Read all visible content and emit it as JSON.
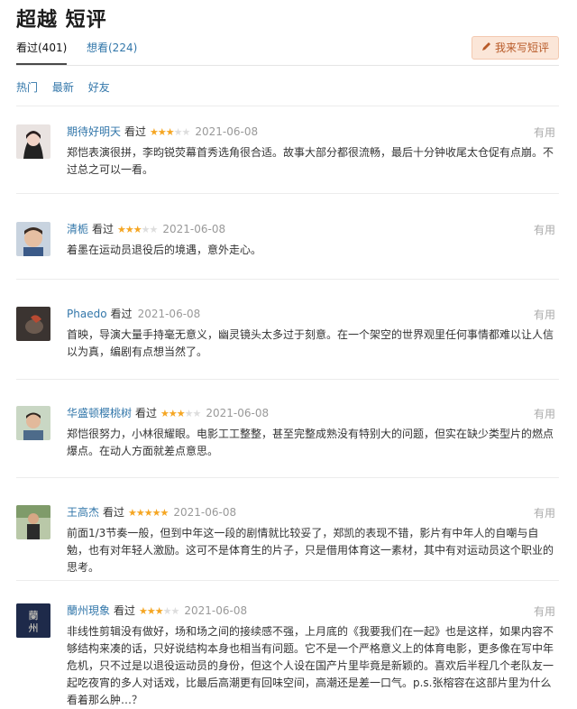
{
  "title": "超越 短评",
  "tabs": [
    {
      "label": "看过(401)"
    },
    {
      "label": "想看(224)"
    }
  ],
  "write_button": "我来写短评",
  "filters": [
    "热门",
    "最新",
    "好友"
  ],
  "useful_label": "有用",
  "saw_label": "看过",
  "colors": {
    "link": "#3377aa",
    "star": "#f5a623",
    "button_bg": "#fbe6d8"
  },
  "reviews": [
    {
      "name": "期待好明天",
      "rating": 3,
      "date": "2021-06-08",
      "text": "郑恺表演很拼，李昀锐荧幕首秀选角很合适。故事大部分都很流畅，最后十分钟收尾太仓促有点崩。不过总之可以一看。"
    },
    {
      "name": "清栀",
      "rating": 3,
      "date": "2021-06-08",
      "text": "着墨在运动员退役后的境遇，意外走心。"
    },
    {
      "name": "Phaedo",
      "rating": 0,
      "date": "2021-06-08",
      "text": "首映，导演大量手持毫无意义，幽灵镜头太多过于刻意。在一个架空的世界观里任何事情都难以让人信以为真，编剧有点想当然了。"
    },
    {
      "name": "华盛顿樱桃树",
      "rating": 3,
      "date": "2021-06-08",
      "text": "郑恺很努力，小林很耀眼。电影工工整整，甚至完整成熟没有特别大的问题，但实在缺少类型片的燃点爆点。在动人方面就差点意思。"
    },
    {
      "name": "王高杰",
      "rating": 5,
      "date": "2021-06-08",
      "text": "前面1/3节奏一般，但到中年这一段的剧情就比较妥了，郑凯的表现不错，影片有中年人的自嘲与自勉，也有对年轻人激励。这可不是体育生的片子，只是借用体育这一素材，其中有对运动员这个职业的思考。"
    },
    {
      "name": "蘭州現象",
      "rating": 3,
      "date": "2021-06-08",
      "text": "非线性剪辑没有做好，场和场之间的接续感不强，上月底的《我要我们在一起》也是这样，如果内容不够结构来凑的话，只好说结构本身也相当有问题。它不是一个严格意义上的体育电影，更多像在写中年危机，只不过是以退役运动员的身份，但这个人设在国产片里毕竟是新颖的。喜欢后半程几个老队友一起吃夜宵的多人对话戏，比最后高潮更有回味空间，高潮还是差一口气。p.s.张榕容在这部片里为什么看着那么肿…？",
      "avatar_text": "蘭州"
    }
  ]
}
